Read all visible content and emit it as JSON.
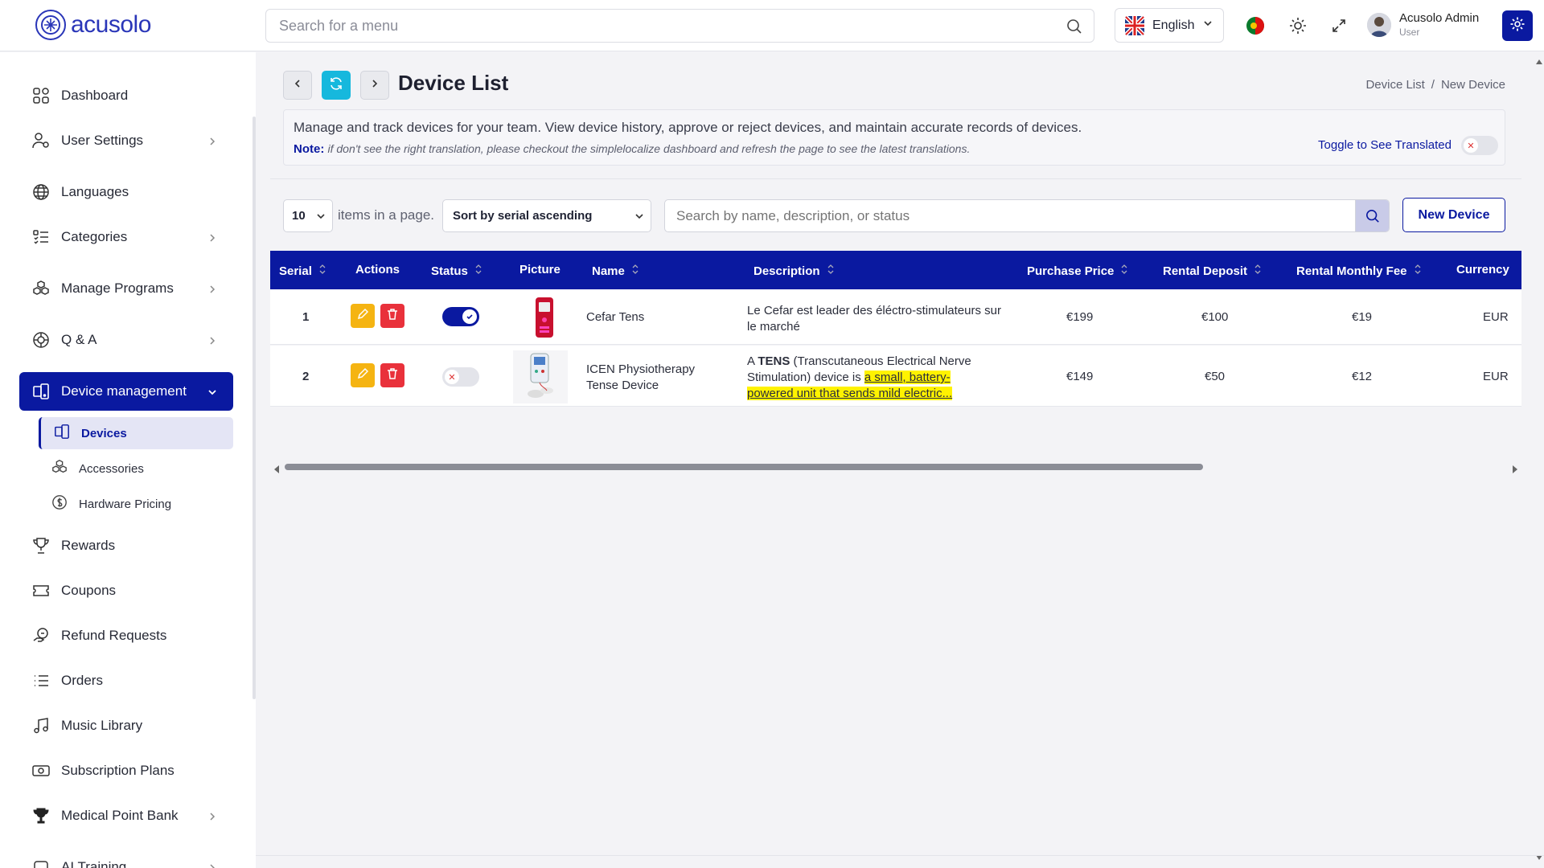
{
  "brand": {
    "name": "acusolo",
    "color": "#2a36b8"
  },
  "colors": {
    "primary": "#0a19a0",
    "edit": "#f5b412",
    "delete": "#e9313b",
    "highlight": "#fff200"
  },
  "topbar": {
    "search_placeholder": "Search for a menu",
    "language": "English",
    "user_name": "Acusolo Admin",
    "user_role": "User"
  },
  "sidebar": {
    "items": [
      {
        "label": "Dashboard",
        "icon": "grid-icon"
      },
      {
        "label": "User Settings",
        "icon": "user-settings-icon",
        "has_children": true
      },
      {
        "label": "Languages",
        "icon": "globe-icon"
      },
      {
        "label": "Categories",
        "icon": "list-check-icon",
        "has_children": true
      },
      {
        "label": "Manage Programs",
        "icon": "cubes-icon",
        "has_children": true
      },
      {
        "label": "Q & A",
        "icon": "qa-icon",
        "has_children": true
      },
      {
        "label": "Device management",
        "icon": "devices-icon",
        "has_children": true,
        "active": true
      },
      {
        "label": "Rewards",
        "icon": "trophy-icon"
      },
      {
        "label": "Coupons",
        "icon": "ticket-icon"
      },
      {
        "label": "Refund Requests",
        "icon": "refund-icon"
      },
      {
        "label": "Orders",
        "icon": "list-icon"
      },
      {
        "label": "Music Library",
        "icon": "music-icon"
      },
      {
        "label": "Subscription Plans",
        "icon": "cash-icon"
      },
      {
        "label": "Medical Point Bank",
        "icon": "trophy-solid-icon",
        "has_children": true
      },
      {
        "label": "AI Training",
        "icon": "ai-icon",
        "has_children": true
      }
    ],
    "sub_items": [
      {
        "label": "Devices",
        "icon": "devices-icon",
        "active": true
      },
      {
        "label": "Accessories",
        "icon": "cubes-icon"
      },
      {
        "label": "Hardware Pricing",
        "icon": "dollar-icon"
      }
    ]
  },
  "page": {
    "title": "Device List",
    "breadcrumb": [
      "Device List",
      "New Device"
    ],
    "description": "Manage and track devices for your team. View device history, approve or reject devices, and maintain accurate records of devices.",
    "note_label": "Note:",
    "note_text": "if don't see the right translation, please checkout the simplelocalize dashboard and refresh the page to see the latest translations.",
    "toggle_label": "Toggle to See Translated"
  },
  "controls": {
    "page_size": "10",
    "items_label": "items in a page.",
    "sort_value": "Sort by serial ascending",
    "search_placeholder": "Search by name, description, or status",
    "new_button": "New Device"
  },
  "table": {
    "headers": [
      "Serial",
      "Actions",
      "Status",
      "Picture",
      "Name",
      "Description",
      "Purchase Price",
      "Rental Deposit",
      "Rental Monthly Fee",
      "Currency"
    ],
    "rows": [
      {
        "serial": "1",
        "status": true,
        "name": "Cefar Tens",
        "description": "Le Cefar est leader des éléctro-stimulateurs sur le marché",
        "purchase_price": "€199",
        "rental_deposit": "€100",
        "rental_monthly_fee": "€19",
        "currency": "EUR"
      },
      {
        "serial": "2",
        "status": false,
        "name_line1": "ICEN Physiotherapy",
        "name_line2": "Tense Device",
        "desc_pre": "A ",
        "desc_bold": "TENS",
        "desc_mid": " (Transcutaneous Electrical Nerve Stimulation) device is ",
        "desc_highlight": "a small, battery-powered unit that sends mild electric...",
        "purchase_price": "€149",
        "rental_deposit": "€50",
        "rental_monthly_fee": "€12",
        "currency": "EUR"
      }
    ]
  }
}
